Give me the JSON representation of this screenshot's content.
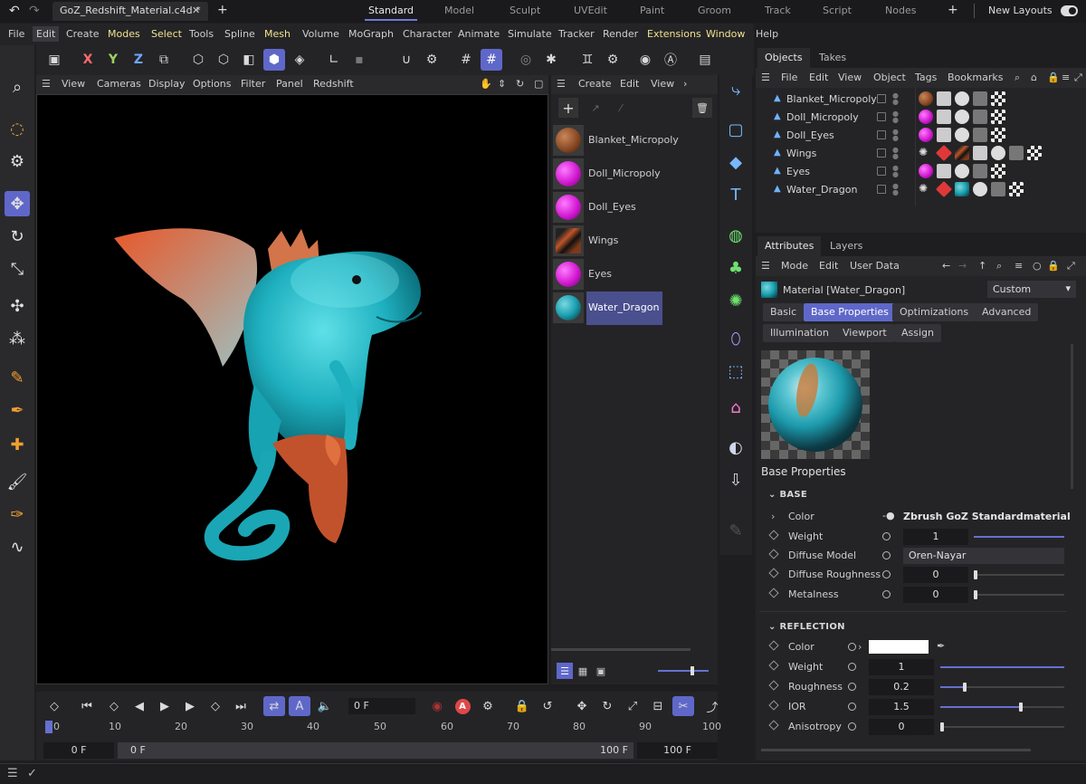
{
  "titlebar": {
    "doc_title": "GoZ_Redshift_Material.c4d *",
    "layouts": [
      "Standard",
      "Model",
      "Sculpt",
      "UVEdit",
      "Paint",
      "Groom",
      "Track",
      "Script",
      "Nodes"
    ],
    "active_layout": "Standard",
    "new_layouts": "New Layouts"
  },
  "menubar": [
    "File",
    "Edit",
    "Create",
    "Modes",
    "Select",
    "Tools",
    "Spline",
    "Mesh",
    "Volume",
    "MoGraph",
    "Character",
    "Animate",
    "Simulate",
    "Tracker",
    "Render",
    "Extensions",
    "Window",
    "Help"
  ],
  "toolbar": {
    "x": "X",
    "y": "Y",
    "z": "Z"
  },
  "viewport_menu": [
    "View",
    "Cameras",
    "Display",
    "Options",
    "Filter",
    "Panel",
    "Redshift"
  ],
  "material_menu": [
    "Create",
    "Edit",
    "View"
  ],
  "materials": [
    {
      "name": "Blanket_Micropoly",
      "color": "#8a4a25"
    },
    {
      "name": "Doll_Micropoly",
      "color": "#d21ad2"
    },
    {
      "name": "Doll_Eyes",
      "color": "#d21ad2"
    },
    {
      "name": "Wings",
      "color": "#6a3a1a"
    },
    {
      "name": "Eyes",
      "color": "#d21ad2"
    },
    {
      "name": "Water_Dragon",
      "color": "#1aa0b0"
    }
  ],
  "selected_material": "Water_Dragon",
  "timeline": {
    "current_frame": "0 F",
    "ruler": [
      "0",
      "10",
      "20",
      "30",
      "40",
      "50",
      "60",
      "70",
      "80",
      "90",
      "100"
    ],
    "start": "0 F",
    "range_start": "0 F",
    "range_end": "100 F",
    "end": "100 F"
  },
  "objects_tabs": [
    "Objects",
    "Takes"
  ],
  "objects_menu": [
    "File",
    "Edit",
    "View",
    "Object",
    "Tags",
    "Bookmarks"
  ],
  "objects": [
    "Blanket_Micropoly",
    "Doll_Micropoly",
    "Doll_Eyes",
    "Wings",
    "Eyes",
    "Water_Dragon"
  ],
  "attributes_tabs": [
    "Attributes",
    "Layers"
  ],
  "attributes_menu": [
    "Mode",
    "Edit",
    "User Data"
  ],
  "attributes": {
    "material_title": "Material [Water_Dragon]",
    "preset": "Custom",
    "tabs": [
      "Basic",
      "Base Properties",
      "Optimizations",
      "Advanced",
      "Illumination",
      "Viewport",
      "Assign"
    ],
    "active_tab": "Base Properties",
    "preview_caption": "Base Properties",
    "base": {
      "title": "BASE",
      "color_label": "Color",
      "color_value": "Zbrush GoZ Standardmaterial",
      "weight_label": "Weight",
      "weight": "1",
      "weight_level": 1.0,
      "diffuse_model_label": "Diffuse Model",
      "diffuse_model": "Oren-Nayar",
      "diffuse_roughness_label": "Diffuse Roughness",
      "diffuse_roughness": "0",
      "diffuse_roughness_level": 0.0,
      "metalness_label": "Metalness",
      "metalness": "0",
      "metalness_level": 0.0
    },
    "reflection": {
      "title": "REFLECTION",
      "color_label": "Color",
      "color_swatch": "#ffffff",
      "weight_label": "Weight",
      "weight": "1",
      "weight_level": 1.0,
      "roughness_label": "Roughness",
      "roughness": "0.2",
      "roughness_level": 0.2,
      "ior_label": "IOR",
      "ior": "1.5",
      "ior_level": 0.65,
      "anisotropy_label": "Anisotropy",
      "anisotropy": "0",
      "anisotropy_level": 0.0
    }
  },
  "colors": {
    "accent": "#5f68c9",
    "highlight_menu": "#f1e28c"
  }
}
